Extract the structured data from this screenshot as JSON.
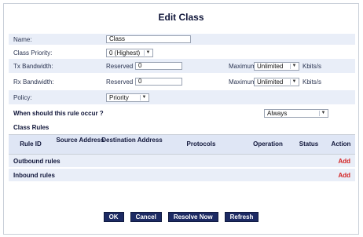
{
  "window": {
    "title": "Edit Class"
  },
  "form": {
    "name": {
      "label": "Name:",
      "value": "Class"
    },
    "class_priority": {
      "label": "Class Priority:",
      "value": "0 (Highest)"
    },
    "tx": {
      "label": "Tx Bandwidth:",
      "reserved_label": "Reserved",
      "reserved_value": "0",
      "maximum_label": "Maximum",
      "maximum_value": "Unlimited",
      "unit": "Kbits/s"
    },
    "rx": {
      "label": "Rx Bandwidth:",
      "reserved_label": "Reserved",
      "reserved_value": "0",
      "maximum_label": "Maximum",
      "maximum_value": "Unlimited",
      "unit": "Kbits/s"
    },
    "policy": {
      "label": "Policy:",
      "value": "Priority"
    },
    "occur": {
      "label": "When should this rule occur ?",
      "value": "Always"
    }
  },
  "class_rules": {
    "title": "Class Rules",
    "columns": [
      "Rule ID",
      "Source Address",
      "Destination Address",
      "Protocols",
      "Operation",
      "Status",
      "Action"
    ],
    "outbound": {
      "label": "Outbound rules",
      "action": "Add"
    },
    "inbound": {
      "label": "Inbound rules",
      "action": "Add"
    }
  },
  "buttons": {
    "ok": "OK",
    "cancel": "Cancel",
    "resolve": "Resolve Now",
    "refresh": "Refresh"
  }
}
